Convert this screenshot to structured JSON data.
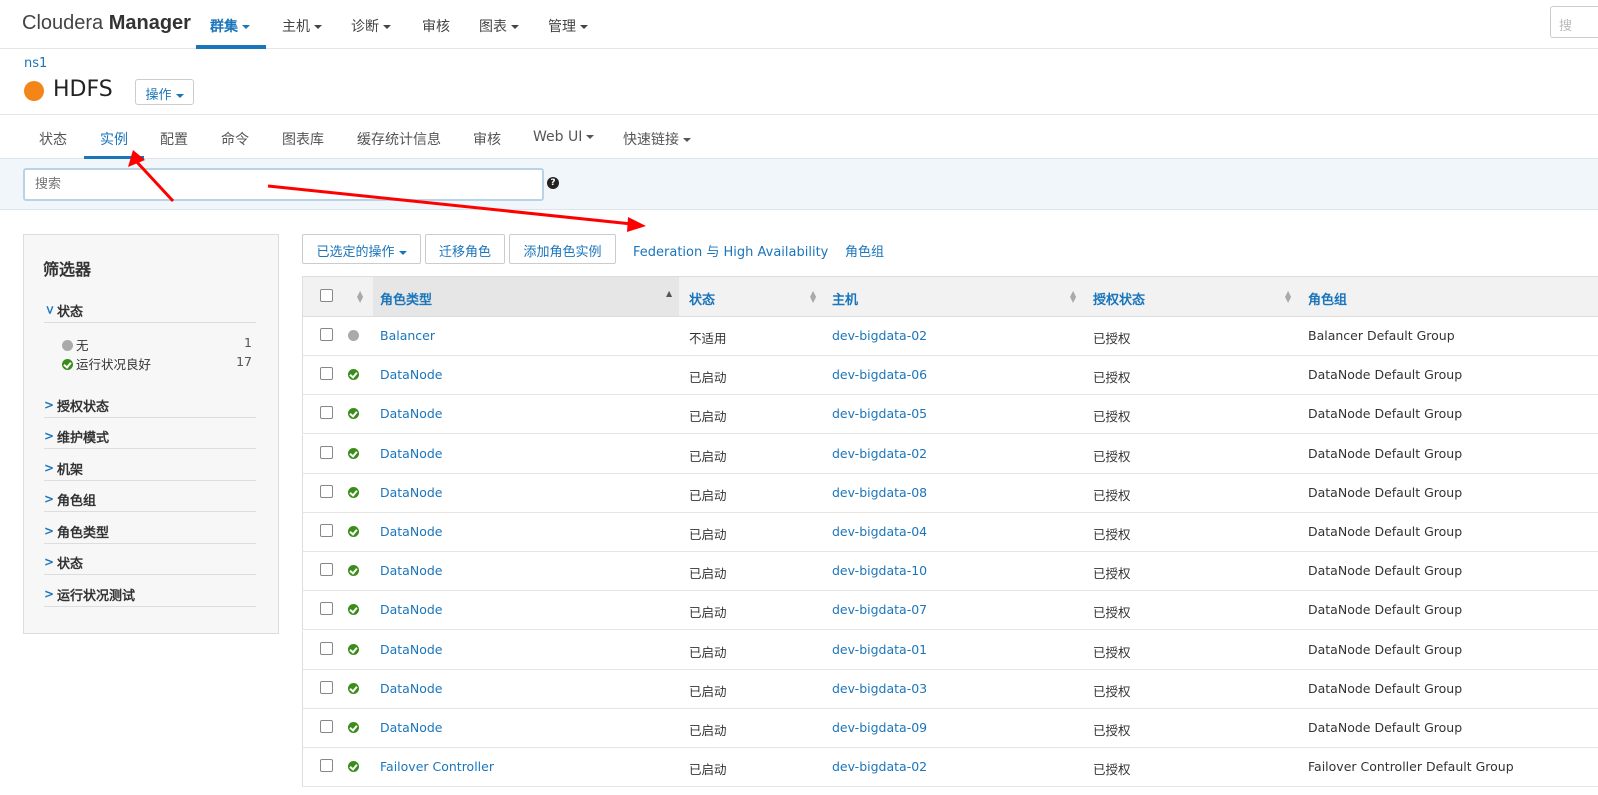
{
  "topnav": {
    "brand_light": "Cloudera ",
    "brand_bold": "Manager",
    "items": [
      {
        "label": "群集",
        "caret": true,
        "active": true
      },
      {
        "label": "主机",
        "caret": true
      },
      {
        "label": "诊断",
        "caret": true
      },
      {
        "label": "审核",
        "caret": false
      },
      {
        "label": "图表",
        "caret": true
      },
      {
        "label": "管理",
        "caret": true
      }
    ],
    "search_placeholder": "搜"
  },
  "service": {
    "breadcrumb": "ns1",
    "name": "HDFS",
    "status_color": "#f48518",
    "ops_label": "操作"
  },
  "subtabs": [
    {
      "label": "状态"
    },
    {
      "label": "实例",
      "active": true
    },
    {
      "label": "配置"
    },
    {
      "label": "命令"
    },
    {
      "label": "图表库"
    },
    {
      "label": "缓存统计信息"
    },
    {
      "label": "审核"
    },
    {
      "label": "Web UI",
      "caret": true
    },
    {
      "label": "快速链接",
      "caret": true
    }
  ],
  "search": {
    "placeholder": "搜索",
    "help": "?"
  },
  "filters": {
    "title": "筛选器",
    "status_section": "状态",
    "status_rows": [
      {
        "label": "无",
        "count": "1",
        "icon": "gray"
      },
      {
        "label": "运行状况良好",
        "count": "17",
        "icon": "green"
      }
    ],
    "sections": [
      "授权状态",
      "维护模式",
      "机架",
      "角色组",
      "角色类型",
      "状态",
      "运行状况测试"
    ]
  },
  "actions": {
    "selected_ops": "已选定的操作",
    "migrate": "迁移角色",
    "add_instance": "添加角色实例",
    "federation": "Federation 与 High Availability",
    "role_groups": "角色组"
  },
  "table": {
    "headers": {
      "role_type": "角色类型",
      "state": "状态",
      "host": "主机",
      "auth": "授权状态",
      "group": "角色组"
    },
    "rows": [
      {
        "status": "gray",
        "role": "Balancer",
        "state": "不适用",
        "host": "dev-bigdata-02",
        "auth": "已授权",
        "group": "Balancer Default Group"
      },
      {
        "status": "green",
        "role": "DataNode",
        "state": "已启动",
        "host": "dev-bigdata-06",
        "auth": "已授权",
        "group": "DataNode Default Group"
      },
      {
        "status": "green",
        "role": "DataNode",
        "state": "已启动",
        "host": "dev-bigdata-05",
        "auth": "已授权",
        "group": "DataNode Default Group"
      },
      {
        "status": "green",
        "role": "DataNode",
        "state": "已启动",
        "host": "dev-bigdata-02",
        "auth": "已授权",
        "group": "DataNode Default Group"
      },
      {
        "status": "green",
        "role": "DataNode",
        "state": "已启动",
        "host": "dev-bigdata-08",
        "auth": "已授权",
        "group": "DataNode Default Group"
      },
      {
        "status": "green",
        "role": "DataNode",
        "state": "已启动",
        "host": "dev-bigdata-04",
        "auth": "已授权",
        "group": "DataNode Default Group"
      },
      {
        "status": "green",
        "role": "DataNode",
        "state": "已启动",
        "host": "dev-bigdata-10",
        "auth": "已授权",
        "group": "DataNode Default Group"
      },
      {
        "status": "green",
        "role": "DataNode",
        "state": "已启动",
        "host": "dev-bigdata-07",
        "auth": "已授权",
        "group": "DataNode Default Group"
      },
      {
        "status": "green",
        "role": "DataNode",
        "state": "已启动",
        "host": "dev-bigdata-01",
        "auth": "已授权",
        "group": "DataNode Default Group"
      },
      {
        "status": "green",
        "role": "DataNode",
        "state": "已启动",
        "host": "dev-bigdata-03",
        "auth": "已授权",
        "group": "DataNode Default Group"
      },
      {
        "status": "green",
        "role": "DataNode",
        "state": "已启动",
        "host": "dev-bigdata-09",
        "auth": "已授权",
        "group": "DataNode Default Group"
      },
      {
        "status": "green",
        "role": "Failover Controller",
        "state": "已启动",
        "host": "dev-bigdata-02",
        "auth": "已授权",
        "group": "Failover Controller Default Group"
      }
    ]
  },
  "colors": {
    "accent": "#1b75bb",
    "healthy": "#3a8d1a",
    "annotation": "#ff0000"
  }
}
